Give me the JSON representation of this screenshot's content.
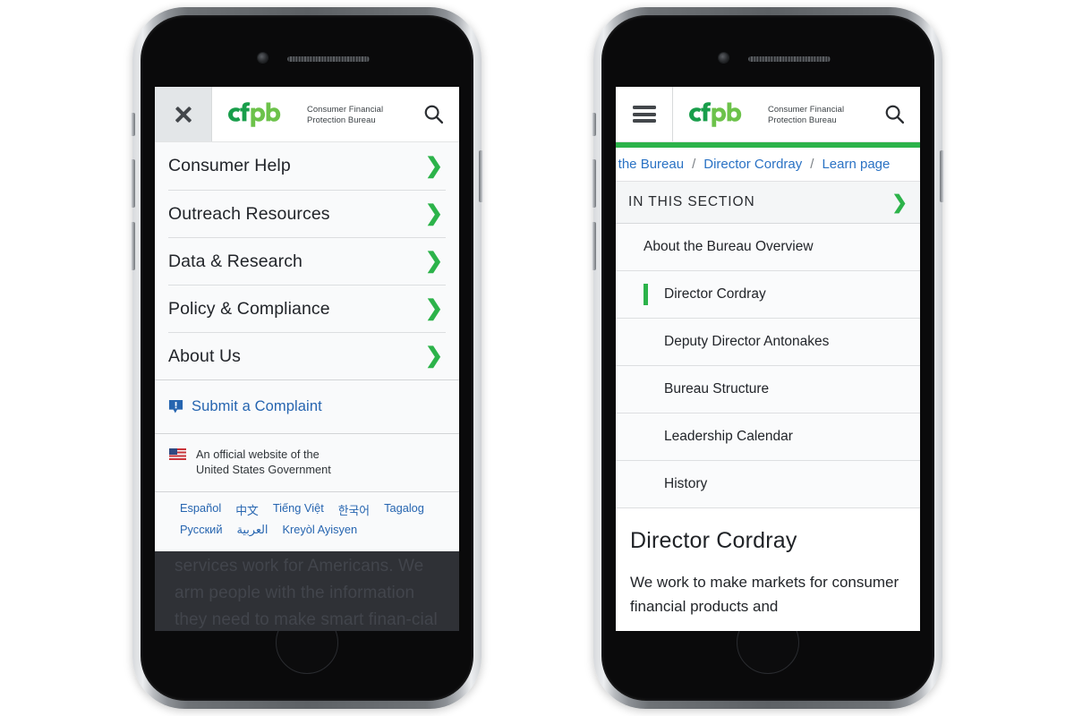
{
  "brand": {
    "logo_text": "cfpb",
    "name_line1": "Consumer Financial",
    "name_line2": "Protection Bureau",
    "green_dark": "#199e4b",
    "green_light": "#6cc24a",
    "accent_green": "#2cb34a",
    "link_blue": "#2a72c4"
  },
  "left_phone": {
    "header": {
      "close_icon": "close-icon",
      "search_icon": "search-icon"
    },
    "menu_items": [
      {
        "label": "Consumer Help",
        "chevron": "chevron-right-icon"
      },
      {
        "label": "Outreach Resources",
        "chevron": "chevron-right-icon"
      },
      {
        "label": "Data & Research",
        "chevron": "chevron-right-icon"
      },
      {
        "label": "Policy & Compliance",
        "chevron": "chevron-right-icon"
      },
      {
        "label": "About Us",
        "chevron": "chevron-right-icon"
      }
    ],
    "complaint": {
      "icon": "complaint-bubble-icon",
      "label": "Submit a Complaint"
    },
    "official": {
      "icon": "us-flag-icon",
      "line1": "An official website of the",
      "line2": "United States Government"
    },
    "languages": [
      "Español",
      "中文",
      "Tiếng Việt",
      "한국어",
      "Tagalog",
      "Русский",
      "العربية",
      "Kreyòl Ayisyen"
    ],
    "dimmed_content": "services work for Americans. We arm people with the information they need to make smart finan-cial decisions, and we protect"
  },
  "right_phone": {
    "header": {
      "menu_icon": "hamburger-icon",
      "search_icon": "search-icon"
    },
    "breadcrumbs": [
      "ut the Bureau",
      "Director Cordray",
      "Learn page"
    ],
    "breadcrumb_separator": "/",
    "section_nav": {
      "title": "IN THIS SECTION",
      "chevron": "chevron-down-icon",
      "items": [
        {
          "label": "About the Bureau Overview",
          "level": 1,
          "active": false
        },
        {
          "label": "Director Cordray",
          "level": 2,
          "active": true
        },
        {
          "label": "Deputy Director Antonakes",
          "level": 2,
          "active": false
        },
        {
          "label": "Bureau Structure",
          "level": 2,
          "active": false
        },
        {
          "label": "Leadership Calendar",
          "level": 2,
          "active": false
        },
        {
          "label": "History",
          "level": 2,
          "active": false
        }
      ]
    },
    "page": {
      "title": "Director Cordray",
      "intro": "We work to make markets for consumer financial products and"
    }
  }
}
